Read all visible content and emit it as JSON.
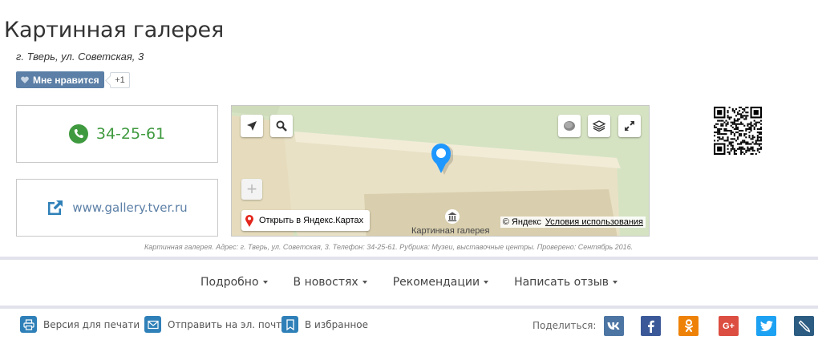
{
  "header": {
    "title": "Картинная галерея",
    "address": "г. Тверь, ул. Советская, 3"
  },
  "like": {
    "label": "Мне нравится",
    "count": "+1"
  },
  "contacts": {
    "phone": "34-25-61",
    "website": "www.gallery.tver.ru"
  },
  "map": {
    "open_label": "Открыть в Яндекс.Картах",
    "copyright": "© Яндекс",
    "terms": "Условия использования",
    "poi_label": "Картинная галерея"
  },
  "caption": "Картинная галерея. Адрес: г. Тверь, ул. Советская, 3. Телефон: 34-25-61. Рубрика: Музеи, выставочные центры. Проверено: Сентябрь 2016.",
  "nav": {
    "items": [
      {
        "label": "Подробно"
      },
      {
        "label": "В новостях"
      },
      {
        "label": "Рекомендации"
      },
      {
        "label": "Написать отзыв"
      }
    ]
  },
  "footer": {
    "print": "Версия для печати",
    "email": "Отправить на эл. почту",
    "favorites": "В избранное",
    "share_label": "Поделиться:"
  },
  "social": [
    {
      "name": "vk-icon",
      "color": "#4c75a3"
    },
    {
      "name": "facebook-icon",
      "color": "#3b5998"
    },
    {
      "name": "odnoklassniki-icon",
      "color": "#ee8208"
    },
    {
      "name": "google-plus-icon",
      "color": "#dc4e41"
    },
    {
      "name": "twitter-icon",
      "color": "#1da1f2"
    },
    {
      "name": "livejournal-icon",
      "color": "#2c5c82"
    }
  ],
  "colors": {
    "accent_blue": "#5b7fa6",
    "phone_green": "#3f9a3f"
  }
}
